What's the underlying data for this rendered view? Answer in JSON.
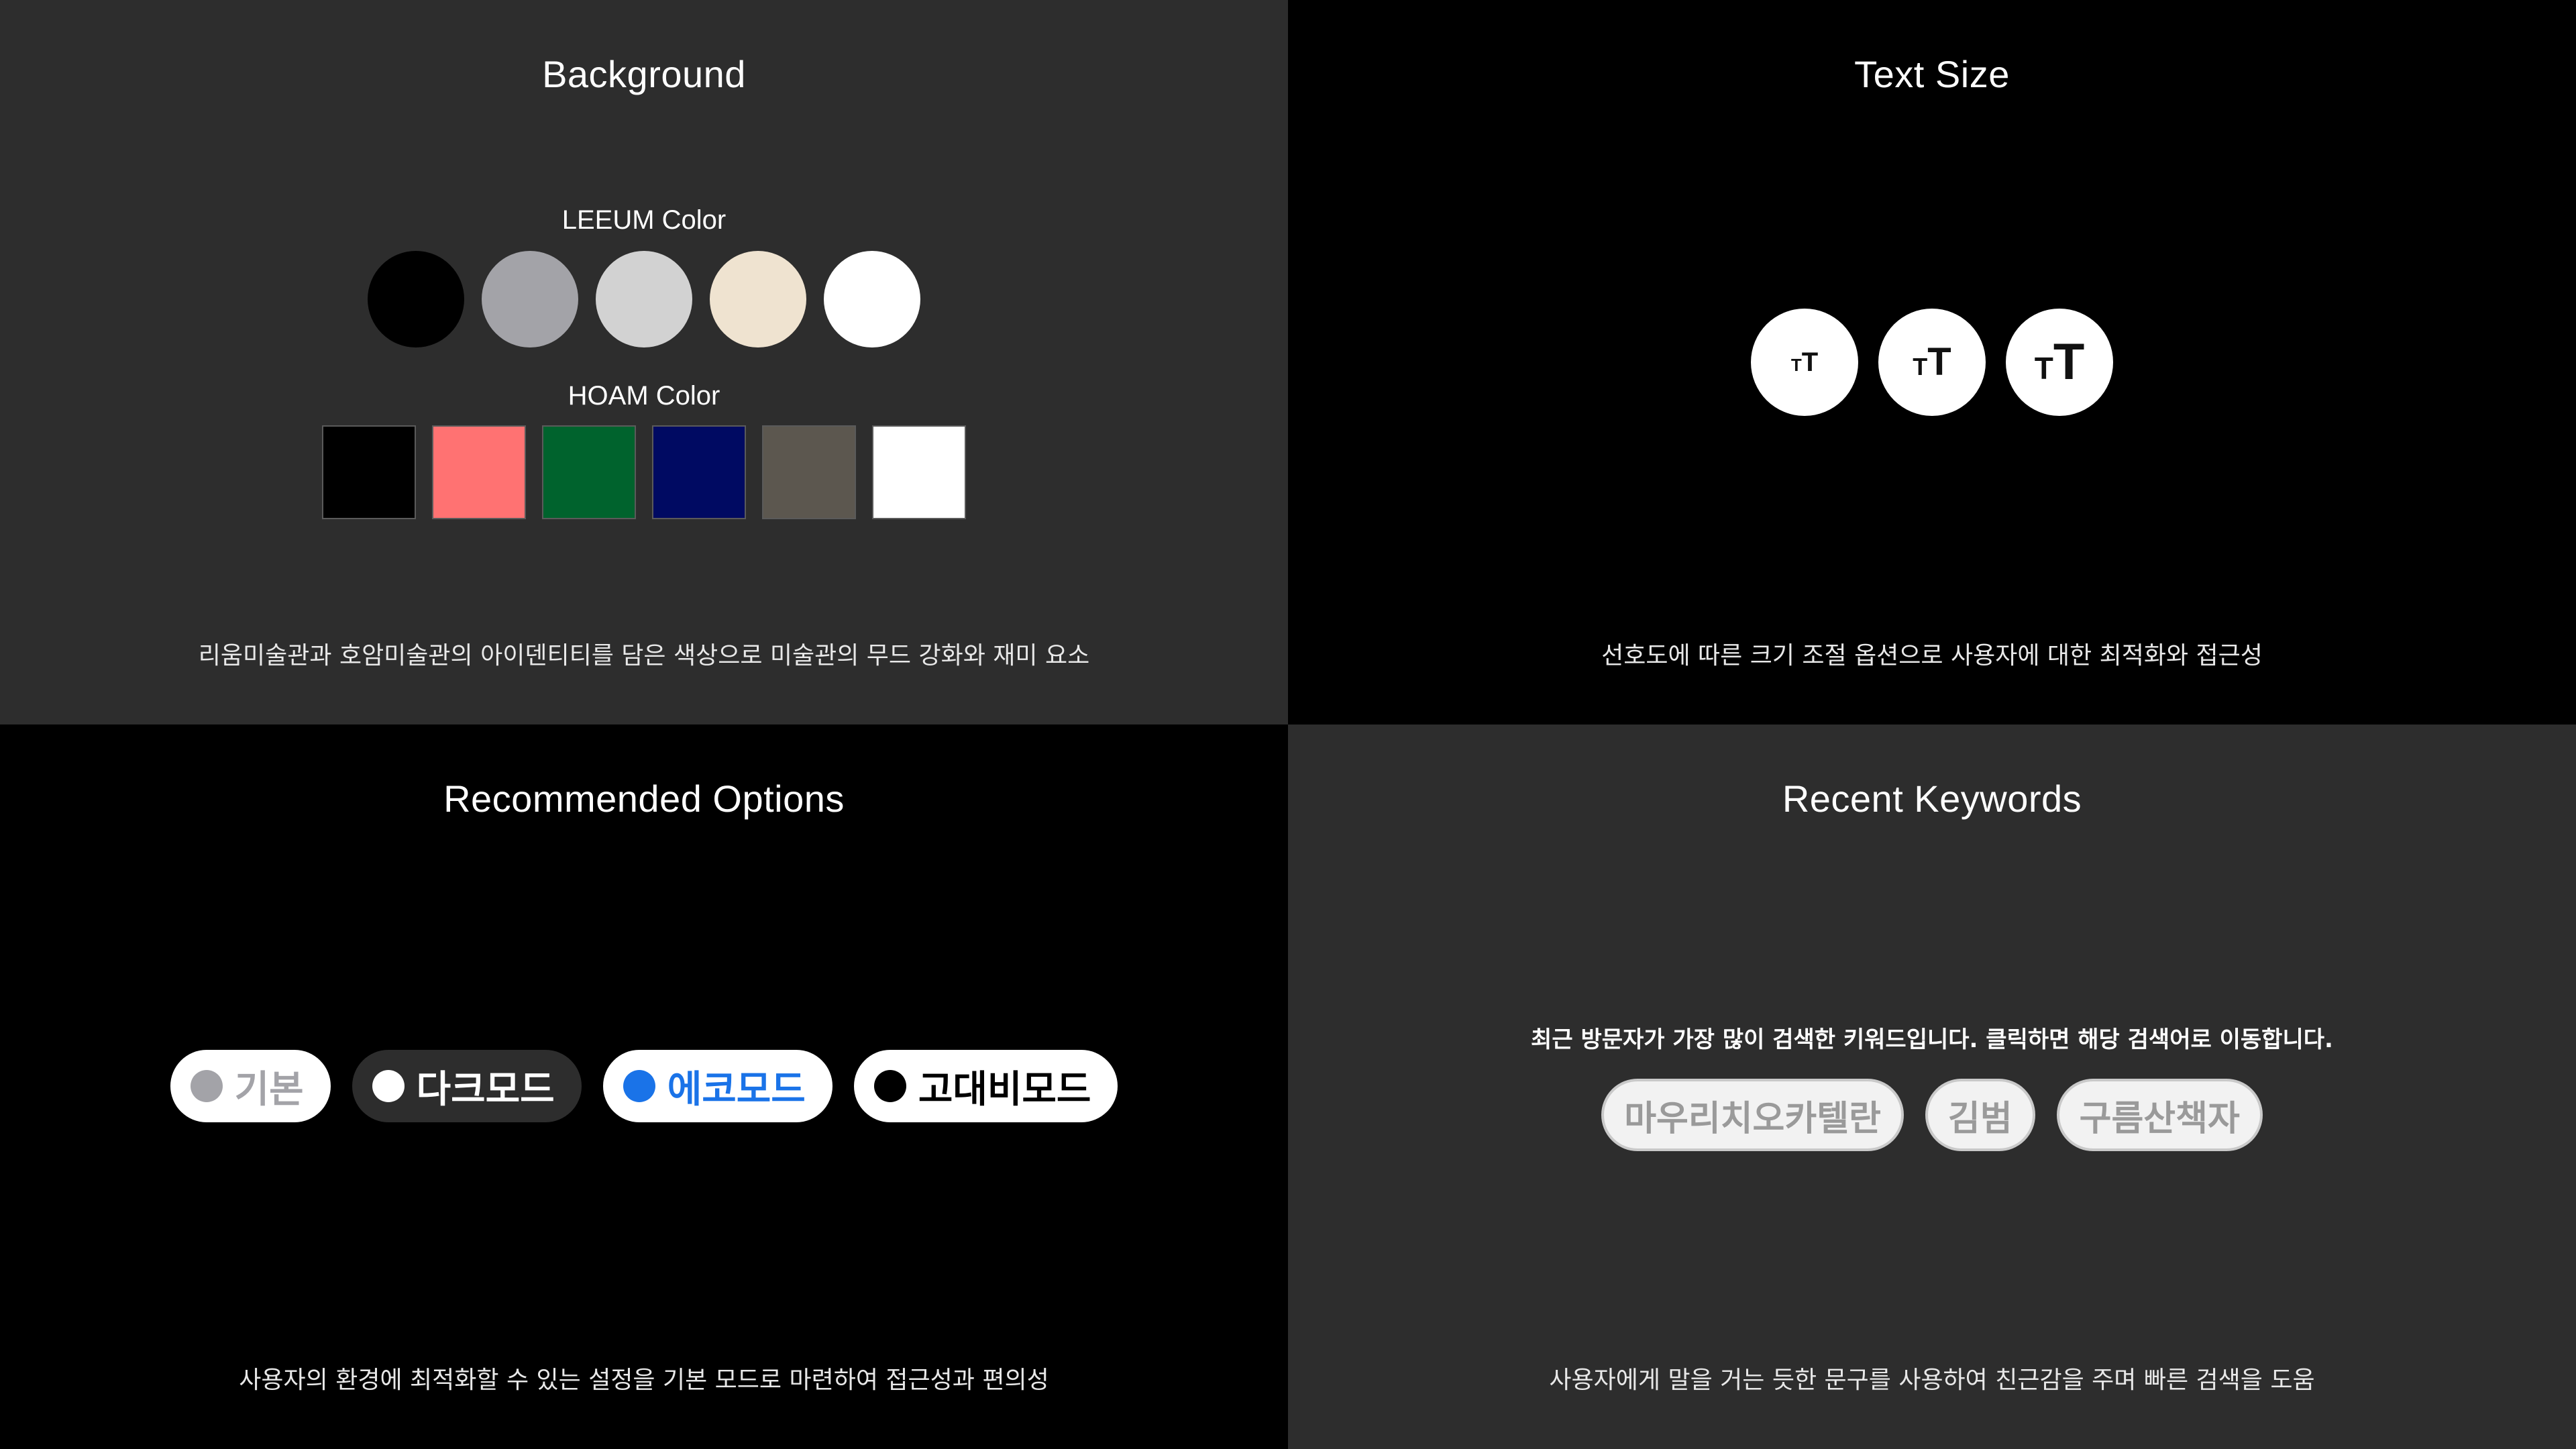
{
  "background": {
    "title": "Background",
    "leeum_label": "LEEUM Color",
    "leeum_colors": [
      "#000000",
      "#a3a3a8",
      "#d2d2d2",
      "#efe3d0",
      "#ffffff"
    ],
    "hoam_label": "HOAM Color",
    "hoam_colors": [
      "#000000",
      "#ff7272",
      "#00632d",
      "#000a62",
      "#5c574f",
      "#ffffff"
    ],
    "description": "리움미술관과 호암미술관의 아이덴티티를 담은 색상으로 미술관의 무드 강화와 재미 요소",
    "panel_color": "#2d2d2d"
  },
  "text_size": {
    "title": "Text Size",
    "buttons": [
      {
        "small": "T",
        "large": "T",
        "size": "small"
      },
      {
        "small": "T",
        "large": "T",
        "size": "medium"
      },
      {
        "small": "T",
        "large": "T",
        "size": "large"
      }
    ],
    "description": "선호도에 따른 크기 조절 옵션으로 사용자에 대한 최적화와 접근성",
    "panel_color": "#000000"
  },
  "recommended": {
    "title": "Recommended Options",
    "options": [
      {
        "label": "기본",
        "bg": "#ffffff",
        "fg": "#a3a3a8",
        "dot": "#a3a3a8"
      },
      {
        "label": "다크모드",
        "bg": "#2d2d2d",
        "fg": "#ffffff",
        "dot": "#ffffff"
      },
      {
        "label": "에코모드",
        "bg": "#ffffff",
        "fg": "#1a73e8",
        "dot": "#1a73e8"
      },
      {
        "label": "고대비모드",
        "bg": "#ffffff",
        "fg": "#000000",
        "dot": "#000000"
      }
    ],
    "description": "사용자의 환경에 최적화할 수 있는 설정을 기본 모드로 마련하여 접근성과 편의성",
    "panel_color": "#000000"
  },
  "keywords": {
    "title": "Recent Keywords",
    "caption": "최근 방문자가 가장 많이 검색한 키워드입니다. 클릭하면 해당 검색어로 이동합니다.",
    "chips": [
      "마우리치오카텔란",
      "김범",
      "구름산책자"
    ],
    "description": "사용자에게 말을 거는 듯한 문구를 사용하여 친근감을 주며 빠른 검색을 도움",
    "panel_color": "#2d2d2d"
  }
}
